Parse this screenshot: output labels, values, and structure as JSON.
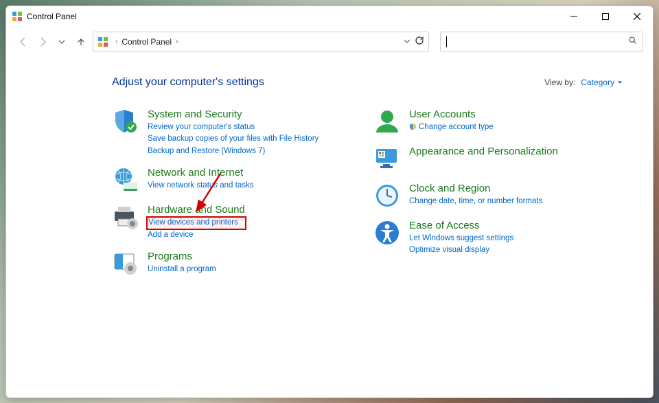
{
  "window": {
    "title": "Control Panel"
  },
  "breadcrumb": {
    "root": "Control Panel"
  },
  "heading": "Adjust your computer's settings",
  "viewby": {
    "label": "View by:",
    "value": "Category"
  },
  "left": {
    "system": {
      "title": "System and Security",
      "s1": "Review your computer's status",
      "s2": "Save backup copies of your files with File History",
      "s3": "Backup and Restore (Windows 7)"
    },
    "network": {
      "title": "Network and Internet",
      "s1": "View network status and tasks"
    },
    "hardware": {
      "title": "Hardware and Sound",
      "s1": "View devices and printers",
      "s2": "Add a device"
    },
    "programs": {
      "title": "Programs",
      "s1": "Uninstall a program"
    }
  },
  "right": {
    "users": {
      "title": "User Accounts",
      "s1": "Change account type"
    },
    "appearance": {
      "title": "Appearance and Personalization"
    },
    "clock": {
      "title": "Clock and Region",
      "s1": "Change date, time, or number formats"
    },
    "ease": {
      "title": "Ease of Access",
      "s1": "Let Windows suggest settings",
      "s2": "Optimize visual display"
    }
  }
}
